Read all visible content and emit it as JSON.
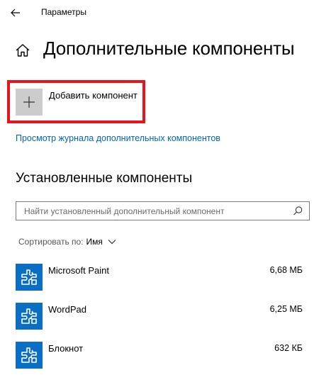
{
  "window": {
    "title": "Параметры"
  },
  "header": {
    "title": "Дополнительные компоненты"
  },
  "add_feature": {
    "label": "Добавить компонент"
  },
  "history_link": {
    "label": "Просмотр журнала дополнительных компонентов"
  },
  "installed": {
    "title": "Установленные компоненты",
    "search_placeholder": "Найти установленный дополнительный компонент",
    "sort_label": "Сортировать по:",
    "sort_value": "Имя",
    "items": [
      {
        "name": "Microsoft Paint",
        "size": "6,68 МБ",
        "icon": "puzzle-icon"
      },
      {
        "name": "WordPad",
        "size": "6,25 МБ",
        "icon": "puzzle-icon"
      },
      {
        "name": "Блокнот",
        "size": "632 КБ",
        "icon": "puzzle-icon"
      }
    ]
  },
  "colors": {
    "accent": "#0a6fc2",
    "link": "#0066b4",
    "highlight": "#e8141c",
    "add_button_bg": "#cccccc"
  }
}
